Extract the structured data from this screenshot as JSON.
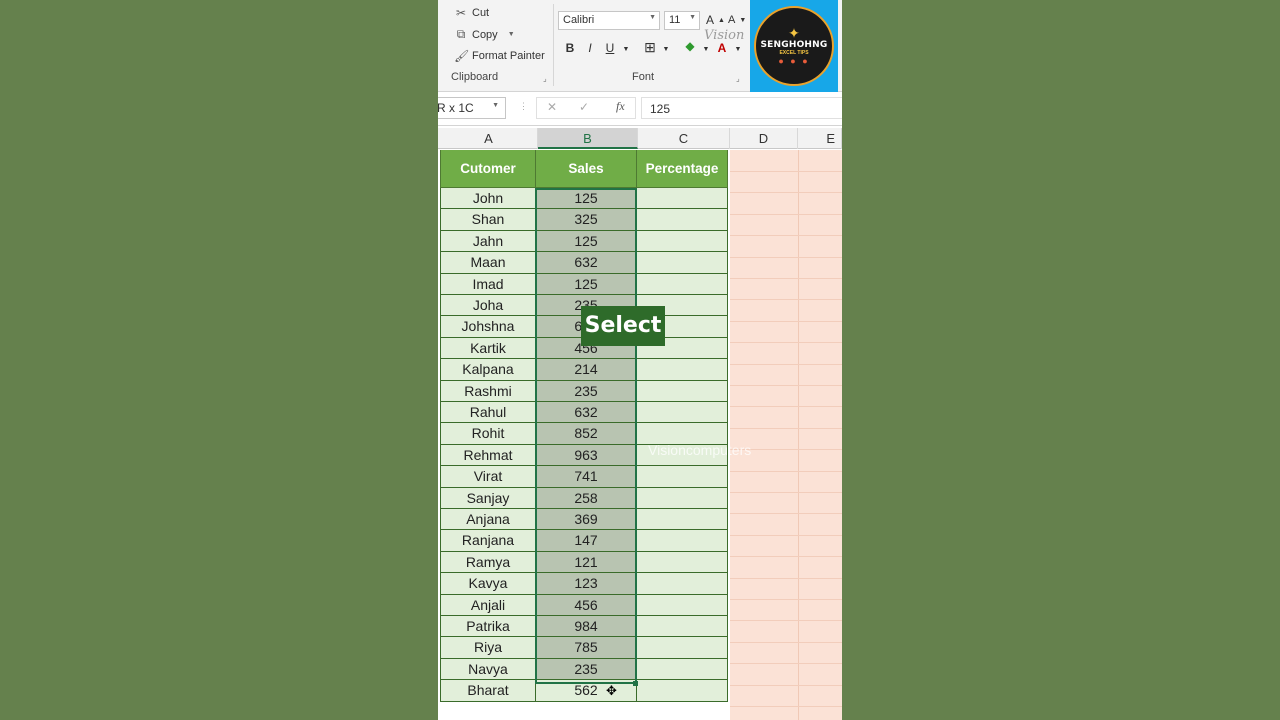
{
  "ribbon": {
    "clipboard": {
      "cut": "Cut",
      "copy": "Copy",
      "format_painter": "Format Painter",
      "label": "Clipboard"
    },
    "font": {
      "name": "Calibri",
      "size": "11",
      "label": "Font",
      "bold": "B",
      "italic": "I",
      "underline": "U"
    }
  },
  "logo": {
    "name": "SENGHOHNG",
    "subtitle": "EXCEL TIPS",
    "watermark": "Vision"
  },
  "formula_bar": {
    "name_box": "R x 1C",
    "fx": "fx",
    "value": "125"
  },
  "columns": [
    "A",
    "B",
    "C",
    "D",
    "E"
  ],
  "selected_column": "B",
  "table": {
    "headers": [
      "Cutomer",
      "Sales",
      "Percentage"
    ],
    "rows": [
      {
        "customer": "John",
        "sales": "125"
      },
      {
        "customer": "Shan",
        "sales": "325"
      },
      {
        "customer": "Jahn",
        "sales": "125"
      },
      {
        "customer": "Maan",
        "sales": "632"
      },
      {
        "customer": "Imad",
        "sales": "125"
      },
      {
        "customer": "Joha",
        "sales": "235"
      },
      {
        "customer": "Johshna",
        "sales": "632"
      },
      {
        "customer": "Kartik",
        "sales": "456"
      },
      {
        "customer": "Kalpana",
        "sales": "214"
      },
      {
        "customer": "Rashmi",
        "sales": "235"
      },
      {
        "customer": "Rahul",
        "sales": "632"
      },
      {
        "customer": "Rohit",
        "sales": "852"
      },
      {
        "customer": "Rehmat",
        "sales": "963"
      },
      {
        "customer": "Virat",
        "sales": "741"
      },
      {
        "customer": "Sanjay",
        "sales": "258"
      },
      {
        "customer": "Anjana",
        "sales": "369"
      },
      {
        "customer": "Ranjana",
        "sales": "147"
      },
      {
        "customer": "Ramya",
        "sales": "121"
      },
      {
        "customer": "Kavya",
        "sales": "123"
      },
      {
        "customer": "Anjali",
        "sales": "456"
      },
      {
        "customer": "Patrika",
        "sales": "984"
      },
      {
        "customer": "Riya",
        "sales": "785"
      },
      {
        "customer": "Navya",
        "sales": "235"
      },
      {
        "customer": "Bharat",
        "sales": "562"
      }
    ]
  },
  "overlay": {
    "label": "Select"
  },
  "watermark": "Visioncomputers",
  "colors": {
    "header_green": "#70ad47",
    "selection_green": "#217346",
    "cell_fill": "#e2efda",
    "background": "#65814d"
  }
}
